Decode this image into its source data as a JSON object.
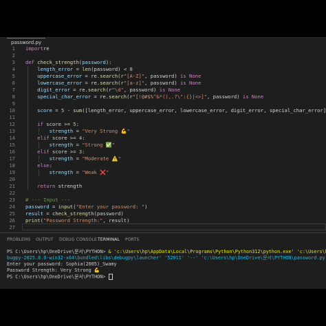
{
  "tab": {
    "filename": "password.py"
  },
  "code_lines": [
    {
      "n": "1",
      "parts": [
        [
          "kw",
          "import"
        ],
        [
          "",
          "re"
        ]
      ]
    },
    {
      "n": "2",
      "parts": []
    },
    {
      "n": "3",
      "parts": [
        [
          "kw",
          "def"
        ],
        [
          "",
          ""
        ],
        [
          "fn",
          "check_strength"
        ],
        [
          "",
          "("
        ],
        [
          "var",
          "password"
        ],
        [
          "",
          "):"
        ]
      ]
    },
    {
      "n": "4",
      "parts": [
        [
          "var",
          "    length_error"
        ],
        [
          "",
          " = "
        ],
        [
          "fn",
          "len"
        ],
        [
          "",
          "(password) < "
        ],
        [
          "num",
          "8"
        ]
      ]
    },
    {
      "n": "5",
      "parts": [
        [
          "var",
          "    uppercase_error"
        ],
        [
          "",
          " = re."
        ],
        [
          "fn",
          "search"
        ],
        [
          "",
          "(r"
        ],
        [
          "str",
          "\"[A-Z]\""
        ],
        [
          "",
          ", password) "
        ],
        [
          "kw",
          "is"
        ],
        [
          "",
          " "
        ],
        [
          "kw",
          "None"
        ]
      ]
    },
    {
      "n": "6",
      "parts": [
        [
          "var",
          "    lowercase_error"
        ],
        [
          "",
          " = re."
        ],
        [
          "fn",
          "search"
        ],
        [
          "",
          "(r"
        ],
        [
          "str",
          "\"[a-z]\""
        ],
        [
          "",
          ", password) "
        ],
        [
          "kw",
          "is"
        ],
        [
          "",
          " "
        ],
        [
          "kw",
          "None"
        ]
      ]
    },
    {
      "n": "7",
      "parts": [
        [
          "var",
          "    digit_error"
        ],
        [
          "",
          " = re."
        ],
        [
          "fn",
          "search"
        ],
        [
          "",
          "(r"
        ],
        [
          "str",
          "\"\\d\""
        ],
        [
          "",
          ", password) "
        ],
        [
          "kw",
          "is"
        ],
        [
          "",
          " "
        ],
        [
          "kw",
          "None"
        ]
      ]
    },
    {
      "n": "8",
      "parts": [
        [
          "var",
          "    special_char_error"
        ],
        [
          "",
          " = re."
        ],
        [
          "fn",
          "search"
        ],
        [
          "",
          "(r"
        ],
        [
          "str",
          "\"[!@#$%^&*(),.?\\\":{}|<>]\""
        ],
        [
          "",
          ", password) "
        ],
        [
          "kw",
          "is"
        ],
        [
          "",
          " "
        ],
        [
          "kw",
          "None"
        ]
      ]
    },
    {
      "n": "9",
      "parts": []
    },
    {
      "n": "10",
      "parts": [
        [
          "var",
          "    score"
        ],
        [
          "",
          " = "
        ],
        [
          "num",
          "5"
        ],
        [
          "",
          " - "
        ],
        [
          "fn",
          "sum"
        ],
        [
          "",
          "([length_error, uppercase_error, lowercase_error, digit_error, special_char_error])"
        ]
      ]
    },
    {
      "n": "11",
      "parts": []
    },
    {
      "n": "12",
      "parts": [
        [
          "kw",
          "    if"
        ],
        [
          "",
          " score >= "
        ],
        [
          "num",
          "5"
        ],
        [
          "",
          ":"
        ]
      ]
    },
    {
      "n": "13",
      "parts": [
        [
          "var",
          "        strength"
        ],
        [
          "",
          " = "
        ],
        [
          "str",
          "\"Very Strong 💪\""
        ]
      ]
    },
    {
      "n": "14",
      "parts": [
        [
          "kw",
          "    elif"
        ],
        [
          "",
          " score >= "
        ],
        [
          "num",
          "4"
        ],
        [
          "",
          ":"
        ]
      ]
    },
    {
      "n": "15",
      "parts": [
        [
          "var",
          "        strength"
        ],
        [
          "",
          " = "
        ],
        [
          "str",
          "\"Strong ✅\""
        ]
      ]
    },
    {
      "n": "16",
      "parts": [
        [
          "kw",
          "    elif"
        ],
        [
          "",
          " score >= "
        ],
        [
          "num",
          "3"
        ],
        [
          "",
          ":"
        ]
      ]
    },
    {
      "n": "17",
      "parts": [
        [
          "var",
          "        strength"
        ],
        [
          "",
          " = "
        ],
        [
          "str",
          "\"Moderate ⚠️\""
        ]
      ]
    },
    {
      "n": "18",
      "parts": [
        [
          "kw",
          "    else"
        ],
        [
          "",
          ":"
        ]
      ]
    },
    {
      "n": "19",
      "parts": [
        [
          "var",
          "        strength"
        ],
        [
          "",
          " = "
        ],
        [
          "str",
          "\"Weak ❌\""
        ]
      ]
    },
    {
      "n": "20",
      "parts": []
    },
    {
      "n": "21",
      "parts": [
        [
          "kw",
          "    return"
        ],
        [
          "",
          " strength"
        ]
      ]
    },
    {
      "n": "22",
      "parts": []
    },
    {
      "n": "23",
      "parts": [
        [
          "cmt",
          "# --- Input ---"
        ]
      ]
    },
    {
      "n": "24",
      "parts": [
        [
          "var",
          "password"
        ],
        [
          "",
          " = "
        ],
        [
          "fn",
          "input"
        ],
        [
          "",
          "("
        ],
        [
          "str",
          "\"Enter your password: \""
        ],
        [
          "",
          ")"
        ]
      ]
    },
    {
      "n": "25",
      "parts": [
        [
          "var",
          "result"
        ],
        [
          "",
          " = "
        ],
        [
          "fn",
          "check_strength"
        ],
        [
          "",
          "(password)"
        ]
      ]
    },
    {
      "n": "26",
      "parts": [
        [
          "fn",
          "print"
        ],
        [
          "",
          "("
        ],
        [
          "str",
          "\"Password Strength:\""
        ],
        [
          "",
          ", result)"
        ]
      ]
    },
    {
      "n": "27",
      "parts": []
    }
  ],
  "panel_tabs": [
    "PROBLEMS",
    "OUTPUT",
    "DEBUG CONSOLE",
    "TERMINAL",
    "PORTS"
  ],
  "active_panel_tab": "TERMINAL",
  "terminal": {
    "line1_prompt": "PS C:\\Users\\hp\\OneDrive\\문서\\PYTHON> ",
    "line1_cmd": "& 'c:\\Users\\hp\\AppData\\Local\\Programs\\Python\\Python312\\python.exe' 'c:\\Users\\hp\\.vscode",
    "line2": "bugpy-2025.8.0-win32-x64\\bundled\\libs\\debugpy\\launcher' '52911' '--' 'c:\\Users\\hp\\OneDrive\\문서\\PYTHON\\password.py'",
    "line3": "Enter your password: Sophia(2005)_Swamy",
    "line4": "Password Strength: Very Strong 💪",
    "line5": "PS C:\\Users\\hp\\OneDrive\\문서\\PYTHON> "
  }
}
